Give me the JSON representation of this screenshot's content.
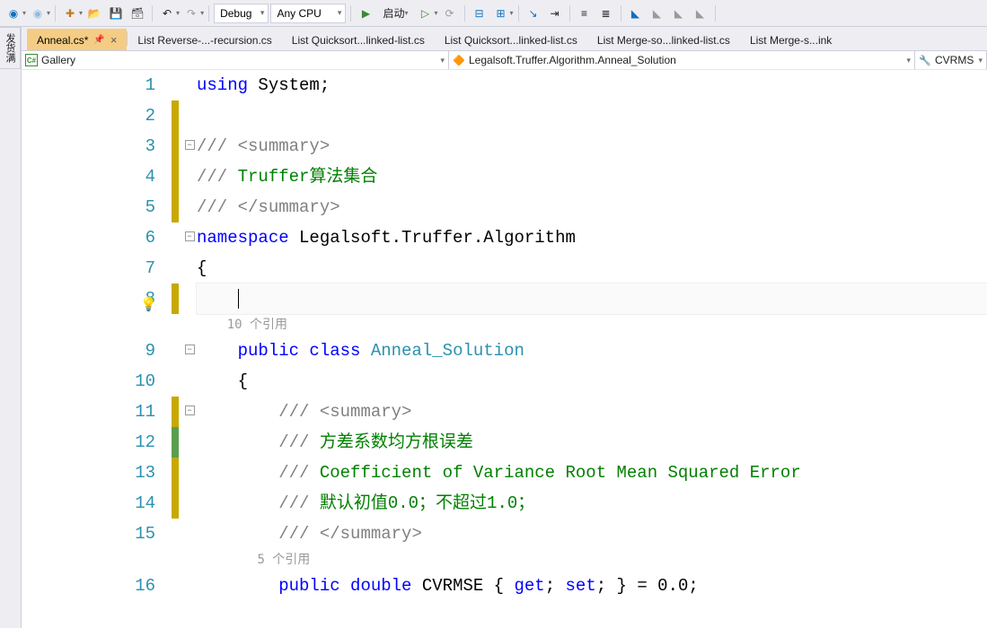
{
  "toolbar": {
    "config": "Debug",
    "platform": "Any CPU",
    "start_label": "启动"
  },
  "sidebar_tab": "发货满",
  "tabs": [
    {
      "label": "Anneal.cs*",
      "active": true,
      "pinned": true
    },
    {
      "label": "List Reverse-...-recursion.cs",
      "active": false
    },
    {
      "label": "List Quicksort...linked-list.cs",
      "active": false
    },
    {
      "label": "List Quicksort...linked-list.cs",
      "active": false
    },
    {
      "label": "List Merge-so...linked-list.cs",
      "active": false
    },
    {
      "label": "List Merge-s...ink",
      "active": false
    }
  ],
  "nav": {
    "scope": "Gallery",
    "member": "Legalsoft.Truffer.Algorithm.Anneal_Solution",
    "right": "CVRMS"
  },
  "refs": {
    "class": "10 个引用",
    "prop": "5 个引用"
  },
  "code": {
    "l1a": "using",
    "l1b": " System;",
    "l3a": "///",
    "l3b": " <summary>",
    "l4a": "///",
    "l4b": " Truffer算法集合",
    "l5a": "///",
    "l5b": " </summary>",
    "l6a": "namespace",
    "l6b": " Legalsoft.Truffer.Algorithm",
    "l7": "{",
    "l9a": "public",
    "l9b": " class",
    "l9c": " Anneal_Solution",
    "l10": "{",
    "l11a": "///",
    "l11b": " <summary>",
    "l12a": "///",
    "l12b": " 方差系数均方根误差",
    "l13a": "///",
    "l13b": " Coefficient of Variance Root Mean Squared Error",
    "l14a": "///",
    "l14b": " 默认初值0.0；不超过1.0；",
    "l15a": "///",
    "l15b": " </summary>",
    "l16a": "public",
    "l16b": " double",
    "l16c": " CVRMSE { ",
    "l16d": "get",
    "l16e": "; ",
    "l16f": "set",
    "l16g": "; } = 0.0;"
  },
  "lines": [
    "1",
    "2",
    "3",
    "4",
    "5",
    "6",
    "7",
    "8",
    "9",
    "10",
    "11",
    "12",
    "13",
    "14",
    "15",
    "16"
  ]
}
